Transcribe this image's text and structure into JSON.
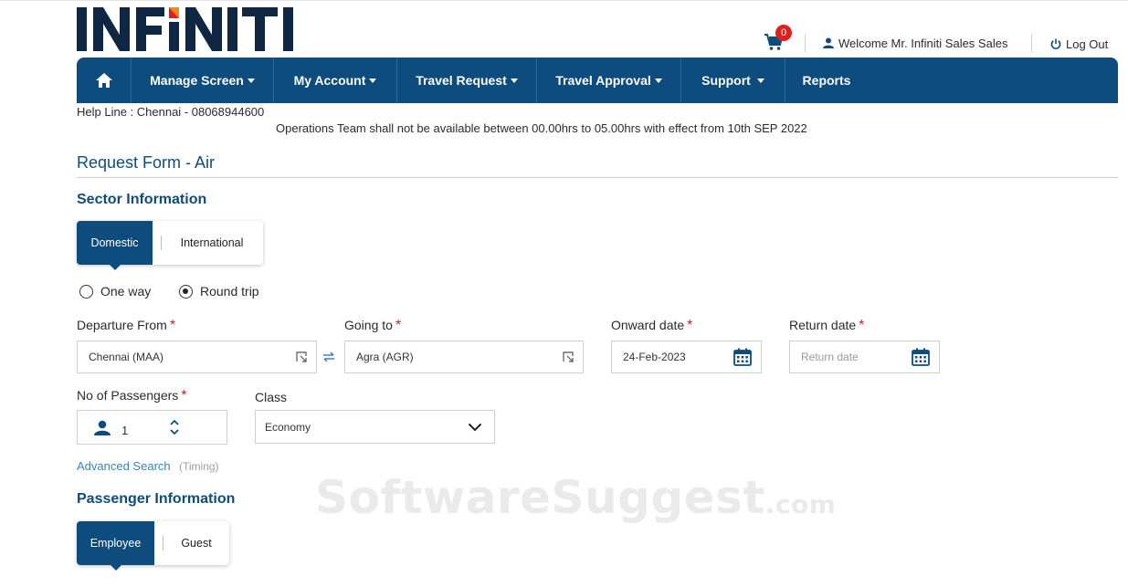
{
  "brand": {
    "logo_text": "INFINITI",
    "colors": {
      "primary": "#0e4c7e",
      "accent": "#e0201b",
      "link": "#3d83b8",
      "required": "#d61f26"
    }
  },
  "header": {
    "cart_count": "0",
    "welcome_text": "Welcome Mr. Infiniti Sales Sales",
    "logout_label": "Log Out"
  },
  "nav": {
    "home_icon": "home-icon",
    "items": [
      {
        "label": "Manage Screen",
        "has_dropdown": true
      },
      {
        "label": "My Account",
        "has_dropdown": true
      },
      {
        "label": "Travel Request",
        "has_dropdown": true
      },
      {
        "label": "Travel Approval",
        "has_dropdown": true
      },
      {
        "label": "Support",
        "has_dropdown": true
      },
      {
        "label": "Reports",
        "has_dropdown": false
      }
    ]
  },
  "helpline": "Help Line : Chennai - 08068944600",
  "notice": "Operations Team shall not be available between 00.00hrs to 05.00hrs with effect from 10th SEP 2022",
  "form": {
    "title": "Request Form - Air",
    "sector": {
      "title": "Sector Information",
      "tabs": [
        "Domestic",
        "International"
      ],
      "active_tab": "Domestic",
      "trip_types": [
        "One way",
        "Round trip"
      ],
      "selected_trip": "Round trip"
    },
    "departure": {
      "label": "Departure From",
      "value": "Chennai (MAA)"
    },
    "going_to": {
      "label": "Going to",
      "value": "Agra (AGR)"
    },
    "onward_date": {
      "label": "Onward date",
      "value": "24-Feb-2023"
    },
    "return_date": {
      "label": "Return date",
      "placeholder": "Return date"
    },
    "passengers": {
      "label": "No of Passengers",
      "value": "1"
    },
    "class": {
      "label": "Class",
      "value": "Economy"
    },
    "advanced_search": {
      "label": "Advanced Search",
      "hint": "(Timing)"
    },
    "passenger_info": {
      "title": "Passenger Information",
      "tabs": [
        "Employee",
        "Guest"
      ],
      "active_tab": "Employee"
    }
  },
  "watermark": {
    "text": "SoftwareSuggest",
    "suffix": ".com"
  }
}
